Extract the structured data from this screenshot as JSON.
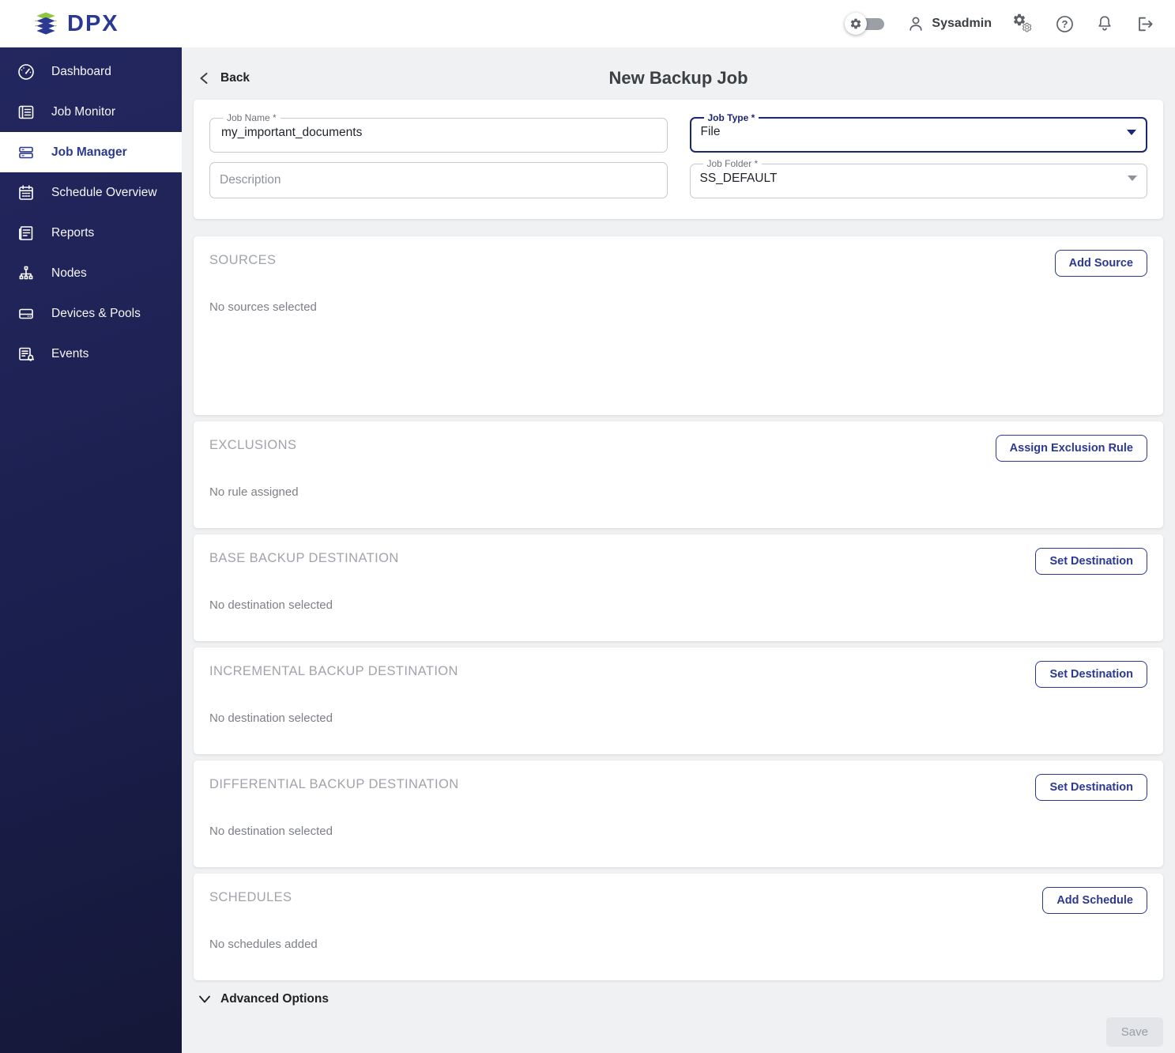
{
  "brand": {
    "name": "DPX"
  },
  "topbar": {
    "username": "Sysadmin"
  },
  "sidebar": {
    "items": [
      {
        "label": "Dashboard",
        "icon": "gauge",
        "active": false
      },
      {
        "label": "Job Monitor",
        "icon": "list",
        "active": false
      },
      {
        "label": "Job Manager",
        "icon": "jobs",
        "active": true
      },
      {
        "label": "Schedule Overview",
        "icon": "calendar",
        "active": false
      },
      {
        "label": "Reports",
        "icon": "report",
        "active": false
      },
      {
        "label": "Nodes",
        "icon": "nodes",
        "active": false
      },
      {
        "label": "Devices & Pools",
        "icon": "device",
        "active": false
      },
      {
        "label": "Events",
        "icon": "events",
        "active": false
      }
    ]
  },
  "header": {
    "back_label": "Back",
    "title": "New Backup Job"
  },
  "form": {
    "job_name": {
      "label": "Job Name *",
      "value": "my_important_documents"
    },
    "description": {
      "placeholder": "Description"
    },
    "job_type": {
      "label": "Job Type *",
      "value": "File"
    },
    "job_folder": {
      "label": "Job Folder *",
      "value": "SS_DEFAULT"
    }
  },
  "sections": [
    {
      "title": "SOURCES",
      "empty_text": "No sources selected",
      "button": "Add Source"
    },
    {
      "title": "EXCLUSIONS",
      "empty_text": "No rule assigned",
      "button": "Assign Exclusion Rule"
    },
    {
      "title": "BASE BACKUP DESTINATION",
      "empty_text": "No destination selected",
      "button": "Set Destination"
    },
    {
      "title": "INCREMENTAL BACKUP DESTINATION",
      "empty_text": "No destination selected",
      "button": "Set Destination"
    },
    {
      "title": "DIFFERENTIAL BACKUP DESTINATION",
      "empty_text": "No destination selected",
      "button": "Set Destination"
    },
    {
      "title": "SCHEDULES",
      "empty_text": "No schedules added",
      "button": "Add Schedule"
    }
  ],
  "footer": {
    "advanced_options": "Advanced Options",
    "save": "Save"
  },
  "colors": {
    "primary": "#2b3990",
    "sidebar_dark": "#1b1f4e",
    "accent_green": "#8dc63f",
    "focus_border": "#1c2674"
  }
}
